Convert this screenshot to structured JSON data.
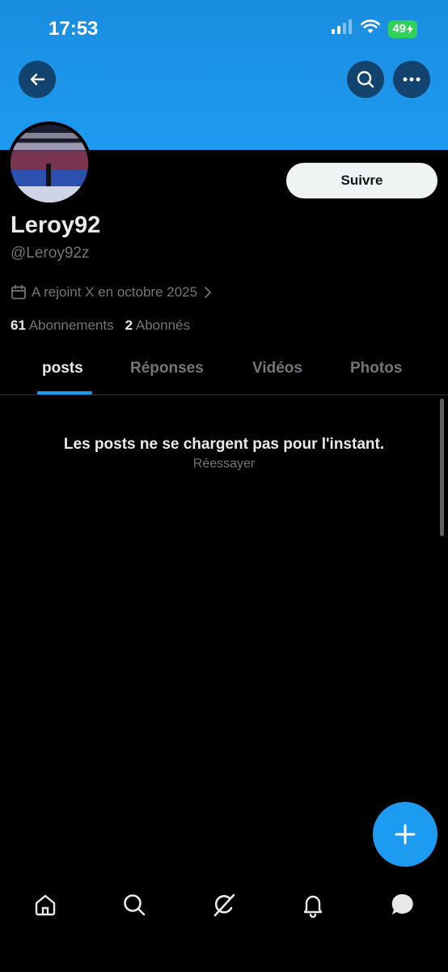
{
  "status": {
    "time": "17:53",
    "battery": "49"
  },
  "profile": {
    "display_name": "Leroy92",
    "handle": "@Leroy92z",
    "joined": "A rejoint X en octobre 2025",
    "following_count": "61",
    "following_label": "Abonnements",
    "followers_count": "2",
    "followers_label": "Abonnés"
  },
  "actions": {
    "follow_label": "Suivre"
  },
  "tabs": [
    {
      "label": "posts"
    },
    {
      "label": "Réponses"
    },
    {
      "label": "Vidéos"
    },
    {
      "label": "Photos"
    }
  ],
  "feed": {
    "error_text": "Les posts ne se chargent pas pour l'instant.",
    "retry_label": "Réessayer"
  },
  "icons": {
    "back": "back-arrow-icon",
    "search": "search-icon",
    "more": "more-icon",
    "calendar": "calendar-icon",
    "chevron": "chevron-right-icon",
    "compose": "plus-icon",
    "home": "home-icon",
    "explore": "search-icon",
    "grok": "grok-icon",
    "notifications": "bell-icon",
    "messages": "message-icon"
  },
  "colors": {
    "accent": "#1d9bf0",
    "background": "#000000",
    "secondary_text": "#71767b"
  }
}
